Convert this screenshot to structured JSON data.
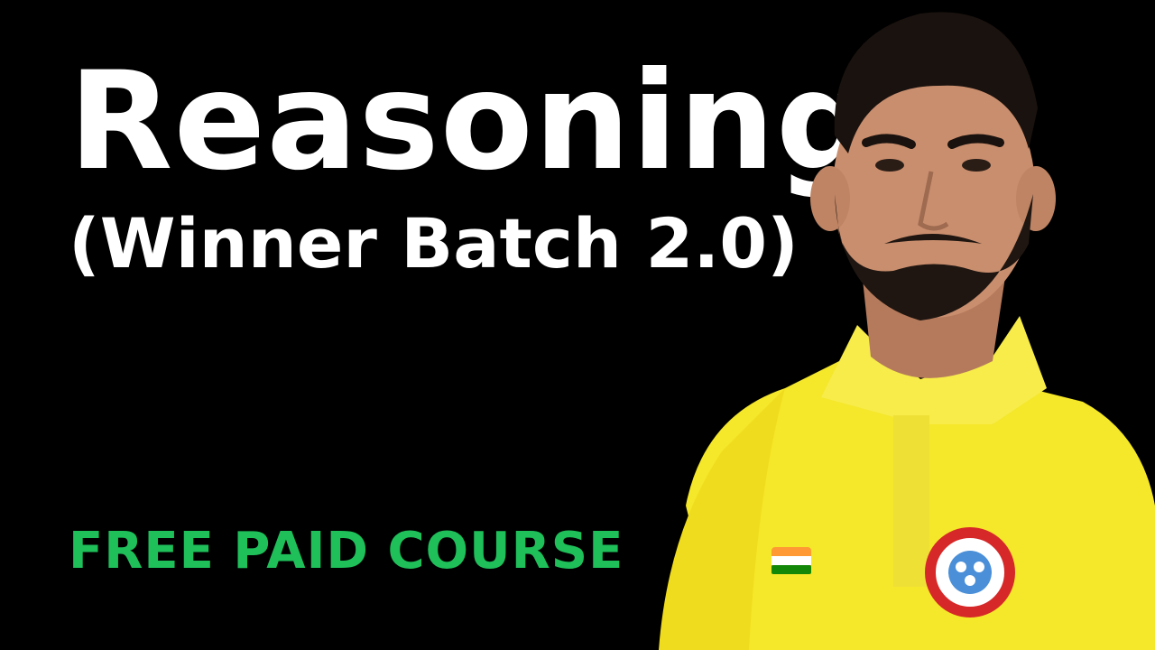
{
  "title": "Reasoning",
  "subtitle": "(Winner Batch 2.0)",
  "tagline": "FREE PAID COURSE",
  "colors": {
    "background": "#000000",
    "title": "#ffffff",
    "tagline": "#1fbf5a",
    "shirt": "#f5e72a",
    "skin": "#c98e6e",
    "hair": "#1a120e"
  },
  "icons": {
    "flag_badge": "flag-badge-icon",
    "logo_badge": "club-logo-icon"
  }
}
